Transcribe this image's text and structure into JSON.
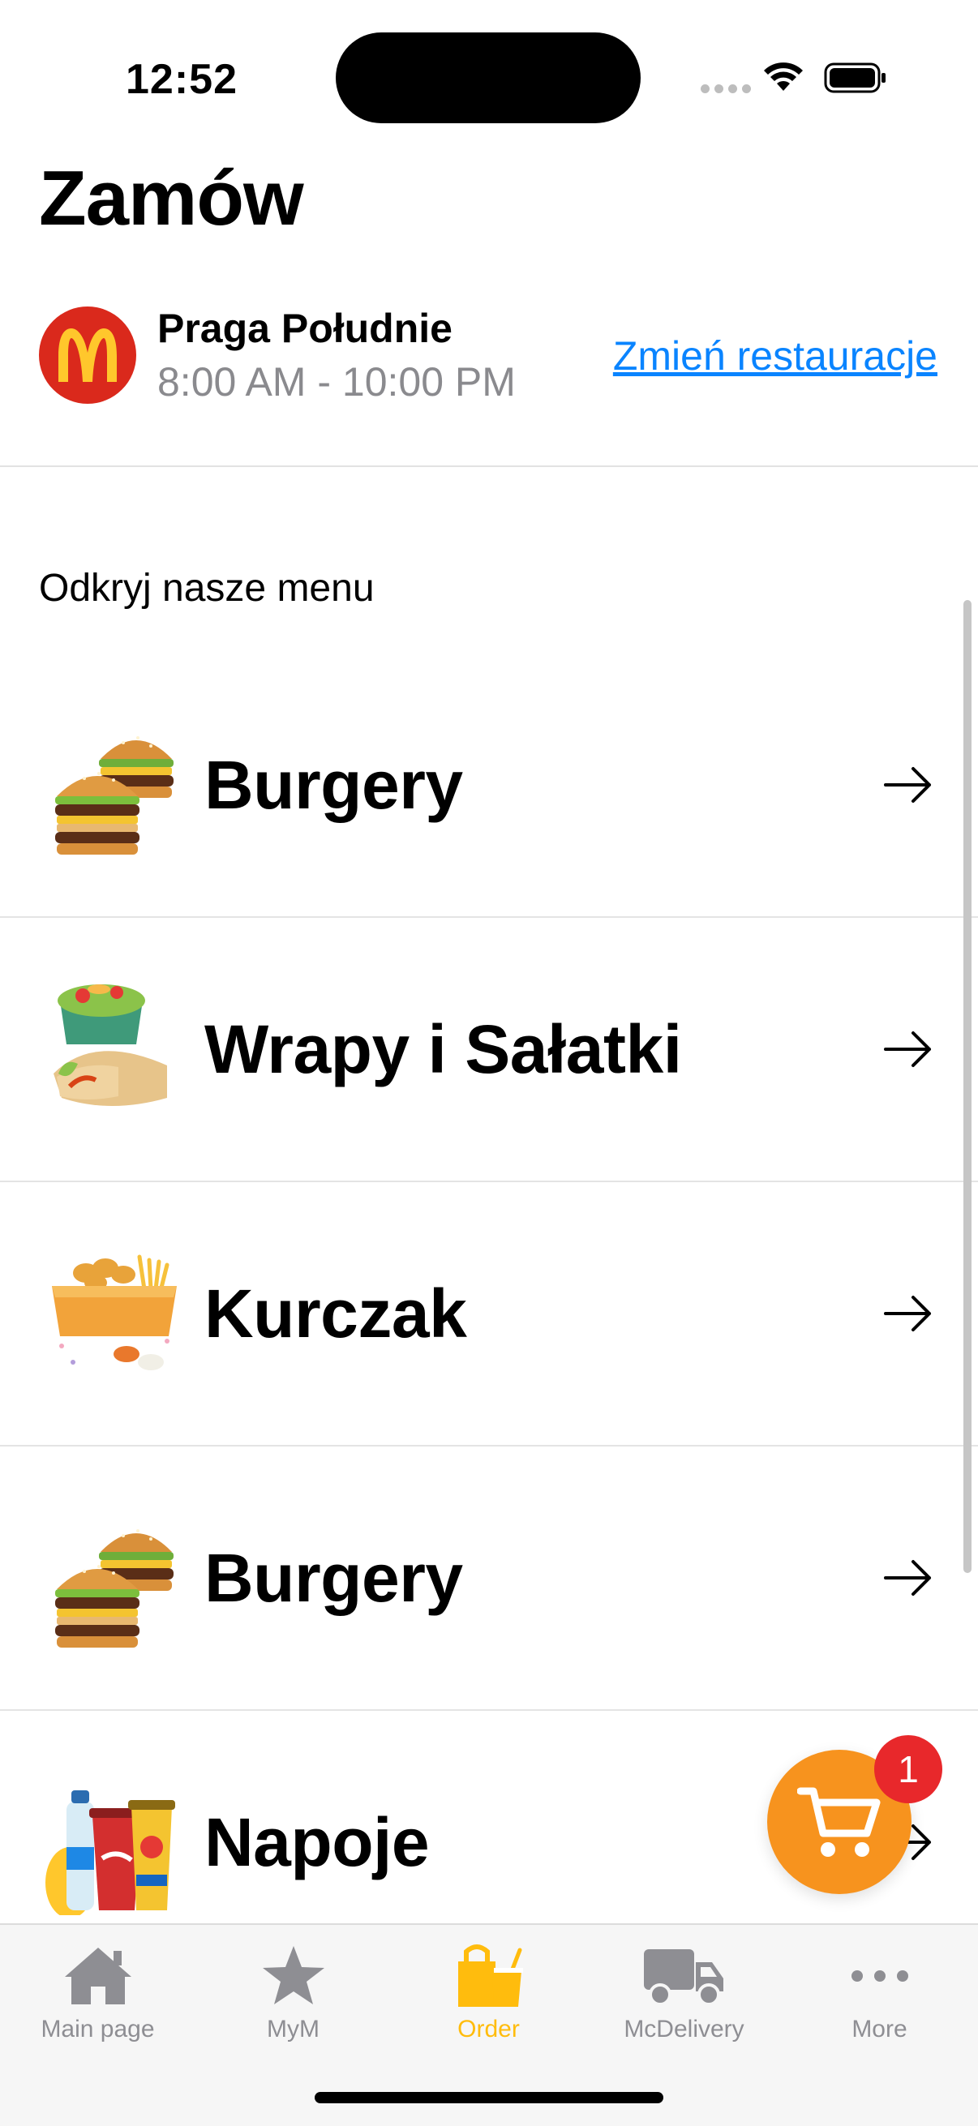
{
  "status_bar": {
    "time": "12:52"
  },
  "header": {
    "title": "Zamów"
  },
  "restaurant": {
    "name": "Praga Południe",
    "hours": "8:00 AM - 10:00 PM",
    "change_label": "Zmień restauracje",
    "logo_icon": "golden-arches-logo",
    "logo_color": "#da291c"
  },
  "menu": {
    "section_label": "Odkryj nasze menu",
    "items": [
      {
        "label": "Burgery",
        "icon": "burgers-image"
      },
      {
        "label": "Wrapy i Sałatki",
        "icon": "wraps-salads-image"
      },
      {
        "label": "Kurczak",
        "icon": "chicken-box-image"
      },
      {
        "label": "Burgery",
        "icon": "burgers-image"
      },
      {
        "label": "Napoje",
        "icon": "drinks-image"
      }
    ]
  },
  "cart": {
    "badge_count": "1",
    "color": "#f7931e",
    "badge_color": "#e8282b"
  },
  "tab_bar": {
    "active_color": "#ffbc0d",
    "tabs": [
      {
        "label": "Main page",
        "icon": "home-icon"
      },
      {
        "label": "MyM",
        "icon": "star-icon"
      },
      {
        "label": "Order",
        "icon": "bag-icon",
        "active": true
      },
      {
        "label": "McDelivery",
        "icon": "truck-icon"
      },
      {
        "label": "More",
        "icon": "more-dots-icon"
      }
    ]
  }
}
